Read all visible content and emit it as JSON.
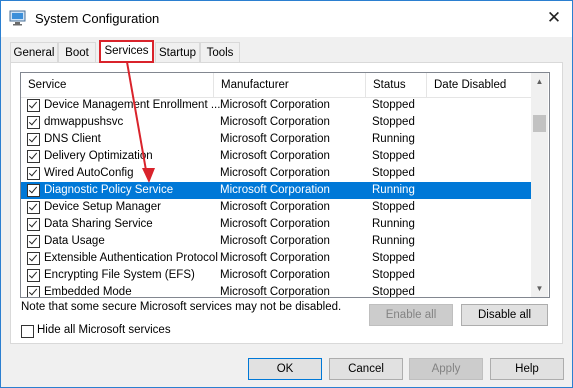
{
  "window": {
    "title": "System Configuration",
    "close_glyph": "✕",
    "icon": "msconfig-app-icon"
  },
  "tabs": [
    {
      "label": "General"
    },
    {
      "label": "Boot"
    },
    {
      "label": "Services"
    },
    {
      "label": "Startup"
    },
    {
      "label": "Tools"
    }
  ],
  "columns": [
    "Service",
    "Manufacturer",
    "Status",
    "Date Disabled"
  ],
  "rows": [
    {
      "name": "Device Management Enrollment ...",
      "manufacturer": "Microsoft Corporation",
      "status": "Stopped",
      "checked": true
    },
    {
      "name": "dmwappushsvc",
      "manufacturer": "Microsoft Corporation",
      "status": "Stopped",
      "checked": true
    },
    {
      "name": "DNS Client",
      "manufacturer": "Microsoft Corporation",
      "status": "Running",
      "checked": true
    },
    {
      "name": "Delivery Optimization",
      "manufacturer": "Microsoft Corporation",
      "status": "Stopped",
      "checked": true
    },
    {
      "name": "Wired AutoConfig",
      "manufacturer": "Microsoft Corporation",
      "status": "Stopped",
      "checked": true
    },
    {
      "name": "Diagnostic Policy Service",
      "manufacturer": "Microsoft Corporation",
      "status": "Running",
      "checked": true,
      "selected": true
    },
    {
      "name": "Device Setup Manager",
      "manufacturer": "Microsoft Corporation",
      "status": "Stopped",
      "checked": true
    },
    {
      "name": "Data Sharing Service",
      "manufacturer": "Microsoft Corporation",
      "status": "Running",
      "checked": true
    },
    {
      "name": "Data Usage",
      "manufacturer": "Microsoft Corporation",
      "status": "Running",
      "checked": true
    },
    {
      "name": "Extensible Authentication Protocol",
      "manufacturer": "Microsoft Corporation",
      "status": "Stopped",
      "checked": true
    },
    {
      "name": "Encrypting File System (EFS)",
      "manufacturer": "Microsoft Corporation",
      "status": "Stopped",
      "checked": true
    },
    {
      "name": "Embedded Mode",
      "manufacturer": "Microsoft Corporation",
      "status": "Stopped",
      "checked": true
    }
  ],
  "note": "Note that some secure Microsoft services may not be disabled.",
  "buttons": {
    "enable_all": "Enable all",
    "disable_all": "Disable all",
    "ok": "OK",
    "cancel": "Cancel",
    "apply": "Apply",
    "help": "Help"
  },
  "hide_ms_label": "Hide all Microsoft services",
  "colors": {
    "selection": "#0078d7",
    "annotation_red": "#d9232b",
    "window_border": "#2b7fd0"
  }
}
